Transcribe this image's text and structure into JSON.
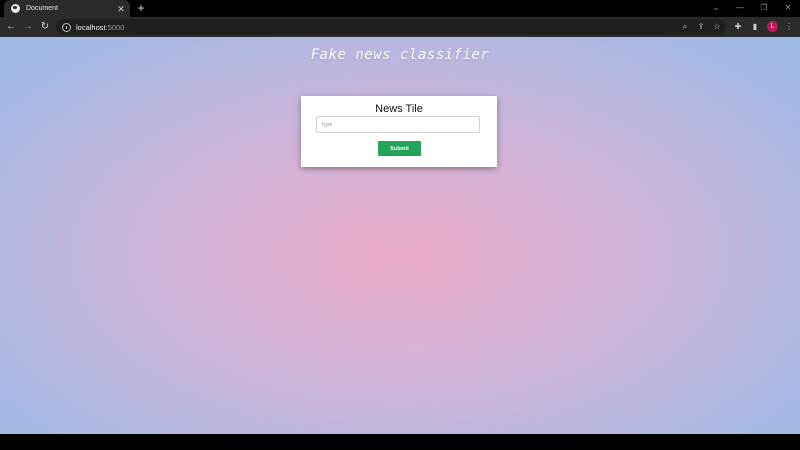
{
  "browser": {
    "tab": {
      "title": "Document",
      "close_glyph": "✕"
    },
    "new_tab_glyph": "+",
    "window_controls": {
      "dropdown": "⌄",
      "minimize": "—",
      "restore": "❐",
      "close": "✕"
    },
    "nav": {
      "back": "←",
      "forward": "→",
      "reload": "↻"
    },
    "address": {
      "host": "localhost",
      "port": ":5000"
    },
    "toolbar_icons": {
      "zoom": "⌕",
      "share": "⇪",
      "bookmark": "☆",
      "extensions": "✚",
      "sidepanel": "▮",
      "menu": "⋮"
    },
    "profile_initial": "L"
  },
  "page": {
    "title": "Fake news classifier",
    "form": {
      "heading": "News Tile",
      "input_placeholder": "type",
      "input_value": "",
      "submit_label": "Submit"
    }
  },
  "colors": {
    "submit_button": "#22a55a",
    "background_center": "#ebacc7",
    "background_edge": "#9ebbe6",
    "profile_avatar": "#c2185b"
  }
}
